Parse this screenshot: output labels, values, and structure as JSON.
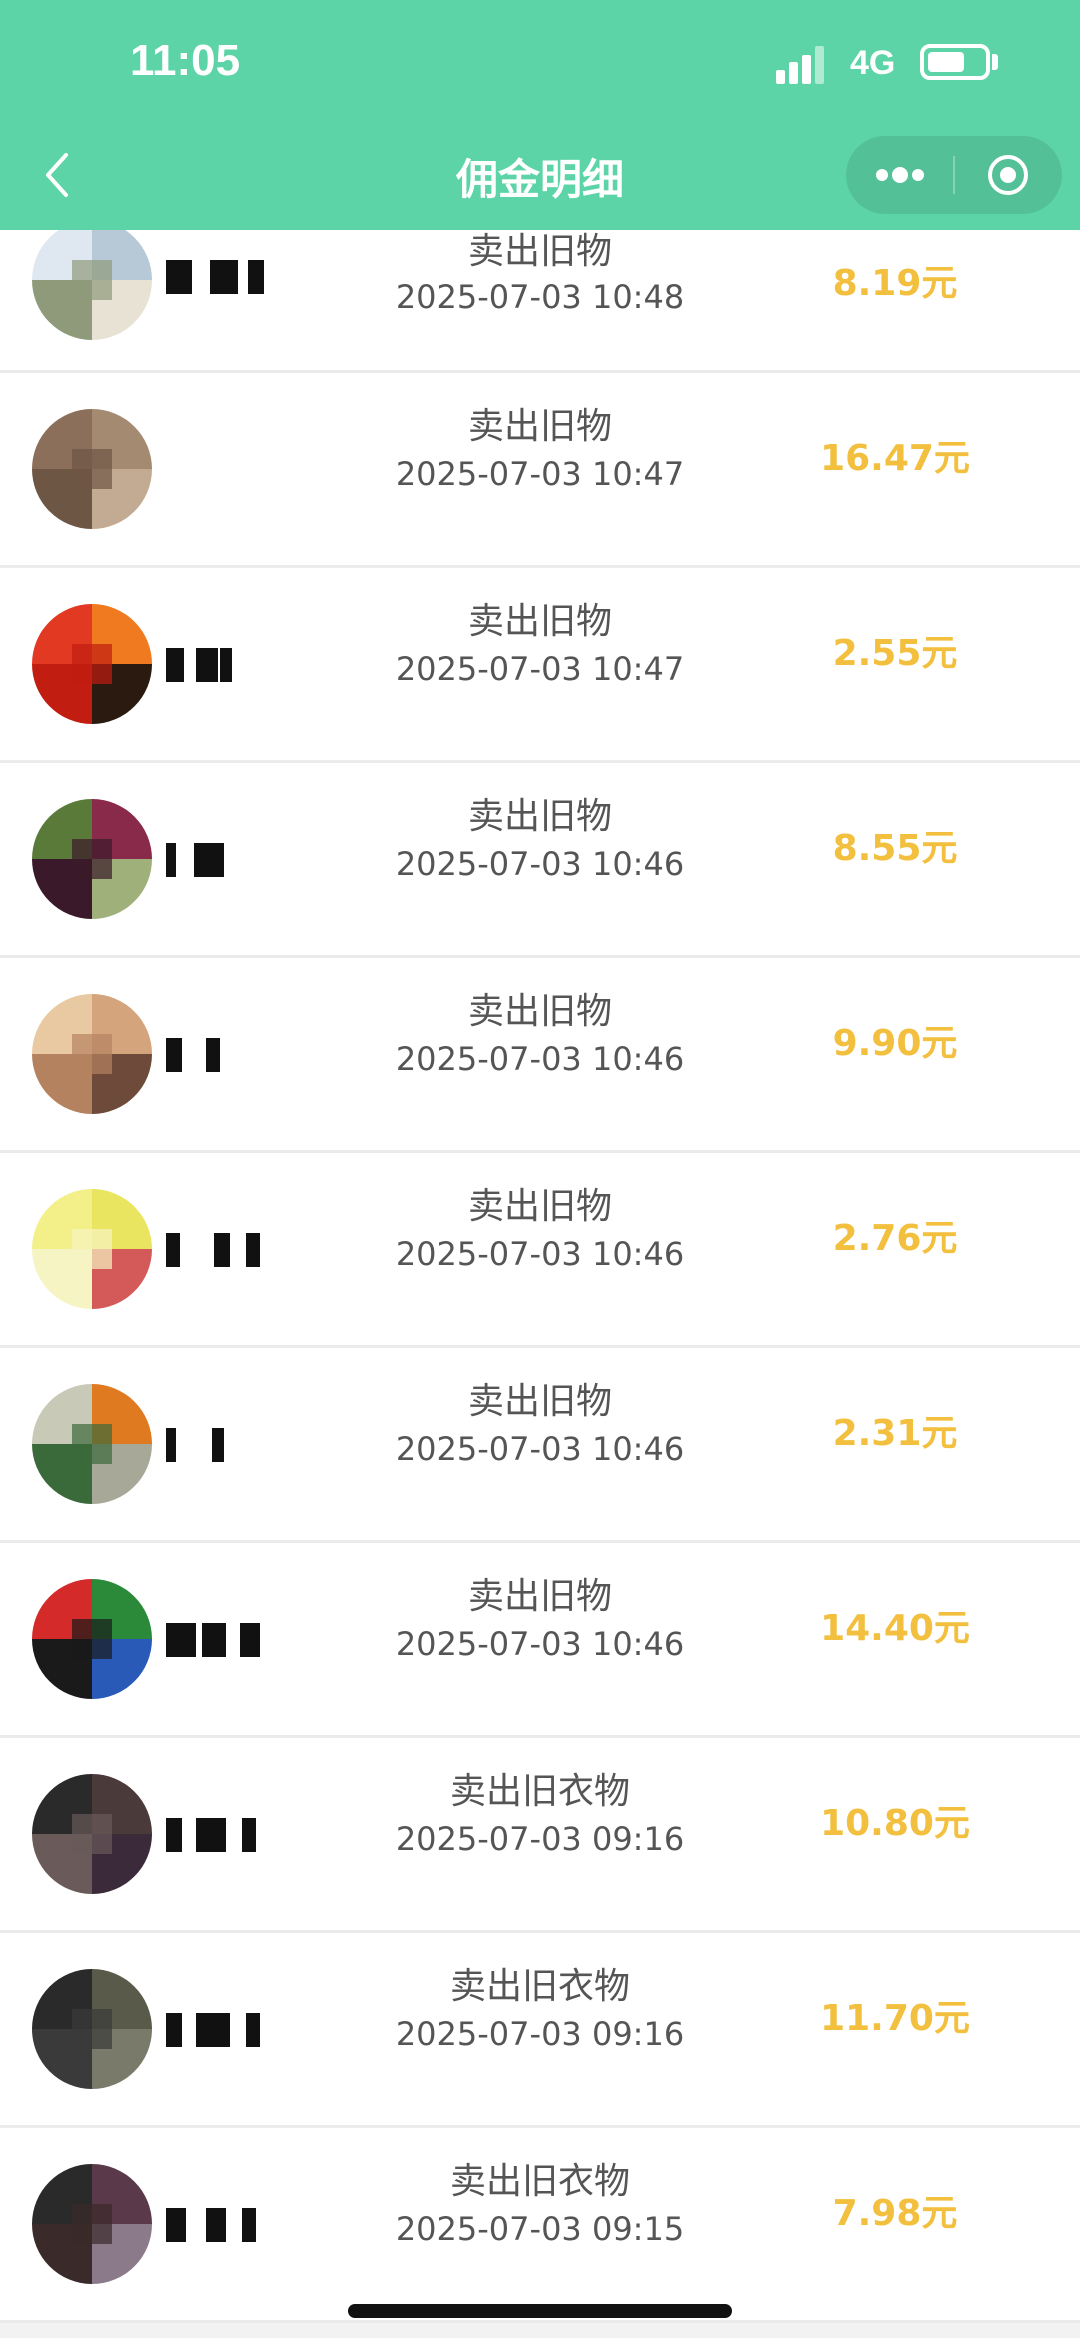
{
  "status_bar": {
    "time": "11:05",
    "network": "4G",
    "battery_level": 0.65
  },
  "nav": {
    "title": "佣金明细",
    "back_icon": "chevron-left-icon",
    "more_icon": "more-dots-icon",
    "close_icon": "target-close-icon"
  },
  "colors": {
    "header_bg": "#5dd4a8",
    "amount": "#f2c03e",
    "text": "#555555"
  },
  "records": [
    {
      "title": "卖出旧物",
      "time": "2025-07-03 10:48",
      "amount": "8.19元",
      "avatar_colors": [
        "#dfe8f0",
        "#b7c9d6",
        "#8f9a7a",
        "#e8e2d4"
      ]
    },
    {
      "title": "卖出旧物",
      "time": "2025-07-03 10:47",
      "amount": "16.47元",
      "avatar_colors": [
        "#8b6f5a",
        "#a58a72",
        "#6e5644",
        "#c2ab92"
      ]
    },
    {
      "title": "卖出旧物",
      "time": "2025-07-03 10:47",
      "amount": "2.55元",
      "avatar_colors": [
        "#e23a22",
        "#f07a20",
        "#c11d10",
        "#2a1a10"
      ]
    },
    {
      "title": "卖出旧物",
      "time": "2025-07-03 10:46",
      "amount": "8.55元",
      "avatar_colors": [
        "#5a7a3a",
        "#8a2a4a",
        "#3a1a2a",
        "#9fb07a"
      ]
    },
    {
      "title": "卖出旧物",
      "time": "2025-07-03 10:46",
      "amount": "9.90元",
      "avatar_colors": [
        "#e9c9a2",
        "#d4a47c",
        "#b58260",
        "#6e4a3a"
      ]
    },
    {
      "title": "卖出旧物",
      "time": "2025-07-03 10:46",
      "amount": "2.76元",
      "avatar_colors": [
        "#f3f08a",
        "#e9e560",
        "#f6f4c2",
        "#d45a5a"
      ]
    },
    {
      "title": "卖出旧物",
      "time": "2025-07-03 10:46",
      "amount": "2.31元",
      "avatar_colors": [
        "#c9c9b8",
        "#e07a20",
        "#3a6a3a",
        "#a8a898"
      ]
    },
    {
      "title": "卖出旧物",
      "time": "2025-07-03 10:46",
      "amount": "14.40元",
      "avatar_colors": [
        "#d42a2a",
        "#2a8a3a",
        "#1a1a1a",
        "#2a5ab8"
      ]
    },
    {
      "title": "卖出旧衣物",
      "time": "2025-07-03 09:16",
      "amount": "10.80元",
      "avatar_colors": [
        "#2a2a2a",
        "#4a3a3a",
        "#6a5a5a",
        "#3a2a3a"
      ]
    },
    {
      "title": "卖出旧衣物",
      "time": "2025-07-03 09:16",
      "amount": "11.70元",
      "avatar_colors": [
        "#2a2a2a",
        "#5a5a4a",
        "#3a3a3a",
        "#7a7a6a"
      ]
    },
    {
      "title": "卖出旧衣物",
      "time": "2025-07-03 09:15",
      "amount": "7.98元",
      "avatar_colors": [
        "#2a2a2a",
        "#5a3a4a",
        "#3a2a2a",
        "#8a7a8a"
      ]
    }
  ]
}
